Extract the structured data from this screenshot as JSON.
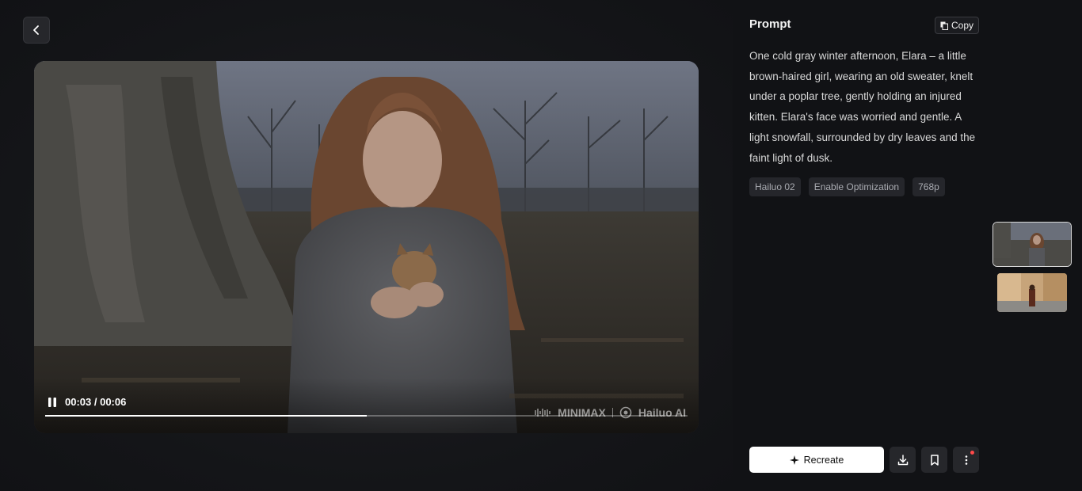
{
  "nav": {
    "back_icon": "chevron-left-icon"
  },
  "video": {
    "current_time": "00:03",
    "total_time": "00:06",
    "time_display": "00:03 / 00:06",
    "progress": 0.5,
    "state_icon": "pause-icon",
    "watermark_brand": "MINIMAX",
    "watermark_product": "Hailuo AI"
  },
  "prompt": {
    "title": "Prompt",
    "copy_label": "Copy",
    "text": "One cold gray winter afternoon, Elara – a little brown-haired girl, wearing an old sweater, knelt under a poplar tree, gently holding an injured kitten. Elara's face was worried and gentle. A light snowfall, surrounded by dry leaves and the faint light of dusk.",
    "tags": [
      "Hailuo 02",
      "Enable Optimization",
      "768p"
    ]
  },
  "actions": {
    "recreate_label": "Recreate",
    "download_icon": "download-icon",
    "bookmark_icon": "bookmark-icon",
    "more_icon": "more-vertical-icon"
  },
  "colors": {
    "background": "#111215",
    "accent_button": "#ffffff",
    "notification_dot": "#ff4a4a"
  }
}
